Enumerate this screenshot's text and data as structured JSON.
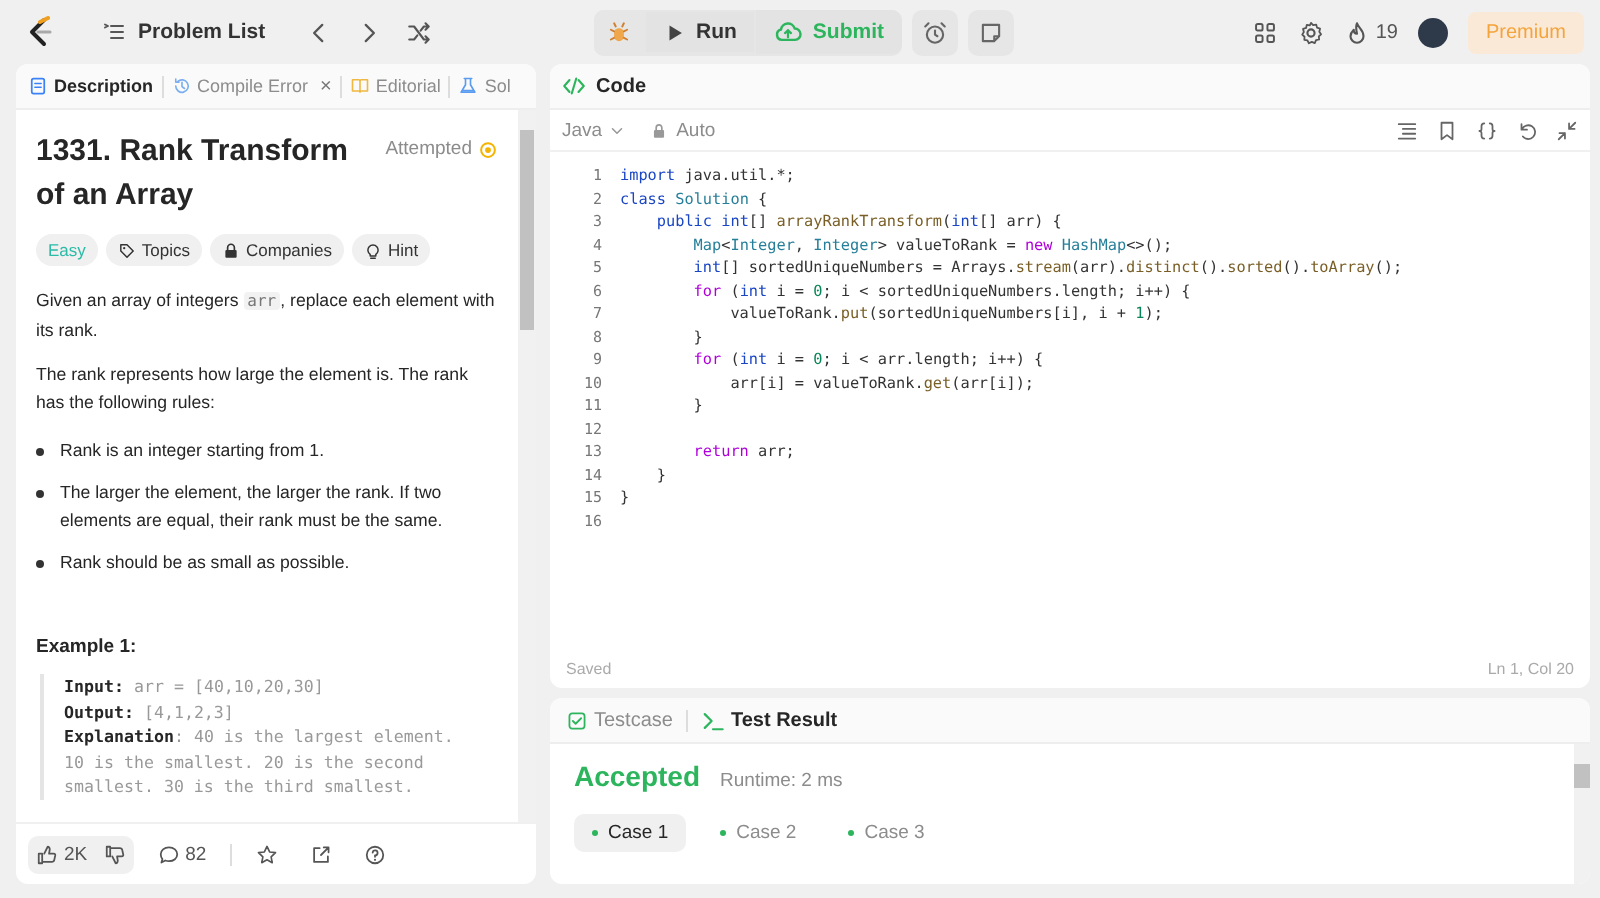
{
  "nav": {
    "problem_list": "Problem List"
  },
  "actions": {
    "run": "Run",
    "submit": "Submit"
  },
  "account": {
    "streak": "19",
    "premium": "Premium"
  },
  "left_tabs": [
    {
      "label": "Description",
      "selected": true
    },
    {
      "label": "Compile Error",
      "selected": false,
      "close_button": "×"
    },
    {
      "label": "Editorial",
      "selected": false
    },
    {
      "label": "Sol",
      "selected": false
    }
  ],
  "problem": {
    "title": "1331. Rank Transform of an Array",
    "status": "Attempted",
    "difficulty": "Easy",
    "tags": [
      {
        "label": "Topics"
      },
      {
        "label": "Companies"
      },
      {
        "label": "Hint"
      }
    ],
    "intro": [
      {
        "kind": "text",
        "text": "Given an array of integers "
      },
      {
        "kind": "code",
        "text": "arr"
      },
      {
        "kind": "text",
        "text": ", replace each element with its rank."
      }
    ],
    "paragraph": "The rank represents how large the element is. The rank has the following rules:",
    "rules": [
      "Rank is an integer starting from 1.",
      "The larger the element, the larger the rank. If two elements are equal, their rank must be the same.",
      "Rank should be as small as possible."
    ],
    "example_title": "Example 1:",
    "example_lines": [
      "**Input:** arr = [40,10,20,30]",
      "**Output:** [4,1,2,3]",
      "**Explanation**: 40 is the largest element.",
      "10 is the smallest. 20 is the second",
      "smallest. 30 is the third smallest."
    ]
  },
  "footer": {
    "likes": "2K",
    "comments": "82"
  },
  "code_panel": {
    "title": "Code",
    "language": "Java",
    "mode": "Auto",
    "saved": "Saved",
    "cursor": "Ln 1, Col 20",
    "lines": [
      {
        "number": "1",
        "tokens": [
          {
            "kind": "kw",
            "text": "import"
          },
          {
            "kind": "plain",
            "text": " java.util.*;"
          }
        ]
      },
      {
        "number": "2",
        "tokens": [
          {
            "kind": "kw",
            "text": "class"
          },
          {
            "kind": "type",
            "text": " Solution"
          },
          {
            "kind": "plain",
            "text": " {"
          }
        ]
      },
      {
        "number": "3",
        "tokens": [
          {
            "kind": "kw",
            "text": "    public"
          },
          {
            "kind": "kw",
            "text": " int"
          },
          {
            "kind": "plain",
            "text": "[] "
          },
          {
            "kind": "fn",
            "text": "arrayRankTransform"
          },
          {
            "kind": "plain",
            "text": "("
          },
          {
            "kind": "kw",
            "text": "int"
          },
          {
            "kind": "plain",
            "text": "[] arr) {"
          }
        ]
      },
      {
        "number": "4",
        "tokens": [
          {
            "kind": "type",
            "text": "        Map"
          },
          {
            "kind": "plain",
            "text": "<"
          },
          {
            "kind": "type",
            "text": "Integer"
          },
          {
            "kind": "plain",
            "text": ", "
          },
          {
            "kind": "type",
            "text": "Integer"
          },
          {
            "kind": "plain",
            "text": "> valueToRank = "
          },
          {
            "kind": "kw2",
            "text": "new"
          },
          {
            "kind": "type",
            "text": " HashMap"
          },
          {
            "kind": "plain",
            "text": "<>();"
          }
        ]
      },
      {
        "number": "5",
        "tokens": [
          {
            "kind": "kw",
            "text": "        int"
          },
          {
            "kind": "plain",
            "text": "[] sortedUniqueNumbers = Arrays."
          },
          {
            "kind": "fn",
            "text": "stream"
          },
          {
            "kind": "plain",
            "text": "(arr)."
          },
          {
            "kind": "fn",
            "text": "distinct"
          },
          {
            "kind": "plain",
            "text": "()."
          },
          {
            "kind": "fn",
            "text": "sorted"
          },
          {
            "kind": "plain",
            "text": "()."
          },
          {
            "kind": "fn",
            "text": "toArray"
          },
          {
            "kind": "plain",
            "text": "();"
          }
        ]
      },
      {
        "number": "6",
        "tokens": [
          {
            "kind": "kw2",
            "text": "        for"
          },
          {
            "kind": "plain",
            "text": " ("
          },
          {
            "kind": "kw",
            "text": "int"
          },
          {
            "kind": "plain",
            "text": " i = "
          },
          {
            "kind": "num",
            "text": "0"
          },
          {
            "kind": "plain",
            "text": "; i < sortedUniqueNumbers.length; i++) {"
          }
        ]
      },
      {
        "number": "7",
        "tokens": [
          {
            "kind": "plain",
            "text": "            valueToRank."
          },
          {
            "kind": "fn",
            "text": "put"
          },
          {
            "kind": "plain",
            "text": "(sortedUniqueNumbers[i], i + "
          },
          {
            "kind": "num",
            "text": "1"
          },
          {
            "kind": "plain",
            "text": ");"
          }
        ]
      },
      {
        "number": "8",
        "tokens": [
          {
            "kind": "plain",
            "text": "        }"
          }
        ]
      },
      {
        "number": "9",
        "tokens": [
          {
            "kind": "kw2",
            "text": "        for"
          },
          {
            "kind": "plain",
            "text": " ("
          },
          {
            "kind": "kw",
            "text": "int"
          },
          {
            "kind": "plain",
            "text": " i = "
          },
          {
            "kind": "num",
            "text": "0"
          },
          {
            "kind": "plain",
            "text": "; i < arr.length; i++) {"
          }
        ]
      },
      {
        "number": "10",
        "tokens": [
          {
            "kind": "plain",
            "text": "            arr[i] = valueToRank."
          },
          {
            "kind": "fn",
            "text": "get"
          },
          {
            "kind": "plain",
            "text": "(arr[i]);"
          }
        ]
      },
      {
        "number": "11",
        "tokens": [
          {
            "kind": "plain",
            "text": "        }"
          }
        ]
      },
      {
        "number": "12"
      },
      {
        "number": "13",
        "tokens": [
          {
            "kind": "kw2",
            "text": "        return"
          },
          {
            "kind": "plain",
            "text": " arr;"
          }
        ]
      },
      {
        "number": "14",
        "tokens": [
          {
            "kind": "plain",
            "text": "    }"
          }
        ]
      },
      {
        "number": "15",
        "tokens": [
          {
            "kind": "plain",
            "text": "}"
          }
        ]
      },
      {
        "number": "16"
      }
    ]
  },
  "result_tabs": [
    {
      "label": "Testcase",
      "selected": false
    },
    {
      "label": "Test Result",
      "selected": true
    }
  ],
  "result": {
    "verdict": "Accepted",
    "runtime": "Runtime: 2 ms",
    "cases": [
      {
        "label": "Case 1",
        "selected": true
      },
      {
        "label": "Case 2",
        "selected": false
      },
      {
        "label": "Case 3",
        "selected": false
      }
    ]
  }
}
